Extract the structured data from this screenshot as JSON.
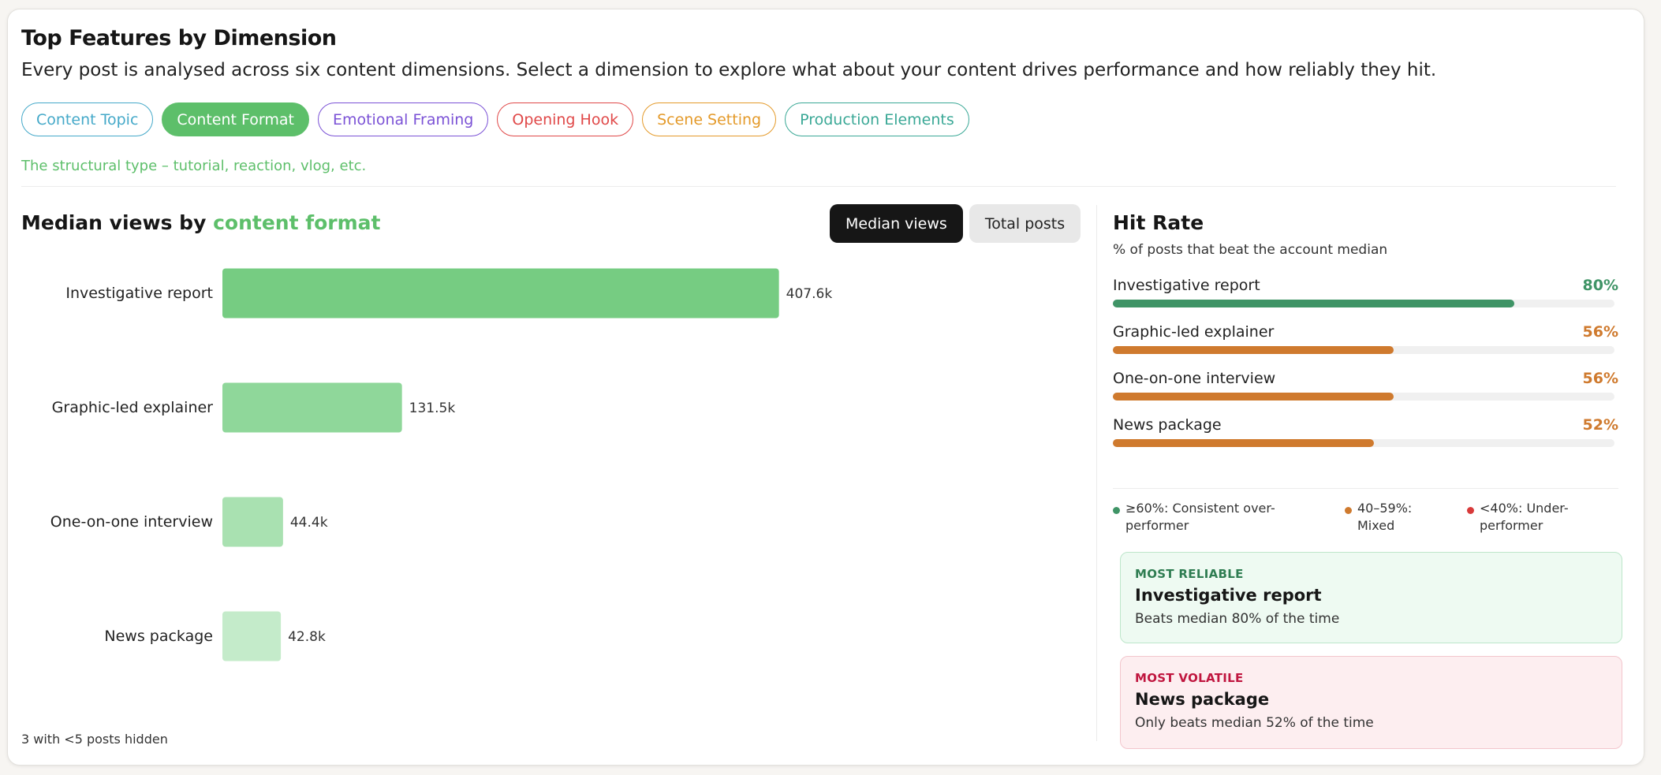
{
  "header": {
    "title": "Top Features by Dimension",
    "subtitle": "Every post is analysed across six content dimensions. Select a dimension to explore what about your content drives performance and how reliably they hit."
  },
  "dimensions": [
    {
      "label": "Content Topic",
      "color": "#45a9c9",
      "active": false
    },
    {
      "label": "Content Format",
      "color": "#5dbf6a",
      "active": true
    },
    {
      "label": "Emotional Framing",
      "color": "#7b52d6",
      "active": false
    },
    {
      "label": "Opening Hook",
      "color": "#e04848",
      "active": false
    },
    {
      "label": "Scene Setting",
      "color": "#e49a2a",
      "active": false
    },
    {
      "label": "Production Elements",
      "color": "#3aa896",
      "active": false
    }
  ],
  "dimension_description": "The structural type – tutorial, reaction, vlog, etc.",
  "chart_header": {
    "prefix": "Median views by",
    "accent": "content format"
  },
  "toggle": {
    "median_label": "Median views",
    "total_label": "Total posts",
    "active": "median"
  },
  "chart_data": {
    "type": "bar",
    "orientation": "horizontal",
    "categories": [
      "Investigative report",
      "Graphic-led explainer",
      "One-on-one interview",
      "News package"
    ],
    "values": [
      407600,
      131500,
      44400,
      42800
    ],
    "value_labels": [
      "407.6k",
      "131.5k",
      "44.4k",
      "42.8k"
    ],
    "bar_colors": [
      "#76cc82",
      "#8fd79a",
      "#a9e1b1",
      "#c4ebca"
    ],
    "xlim": [
      0,
      800000
    ]
  },
  "footnote": "3 with <5 posts hidden",
  "hit_rate": {
    "title": "Hit Rate",
    "subtitle": "% of posts that beat the account median",
    "rows": [
      {
        "label": "Investigative report",
        "pct_text": "80%",
        "pct": 80,
        "color": "#3f9466",
        "text_color": "#3f9466"
      },
      {
        "label": "Graphic-led explainer",
        "pct_text": "56%",
        "pct": 56,
        "color": "#cf7a2e",
        "text_color": "#cf7a2e"
      },
      {
        "label": "One-on-one interview",
        "pct_text": "56%",
        "pct": 56,
        "color": "#cf7a2e",
        "text_color": "#cf7a2e"
      },
      {
        "label": "News package",
        "pct_text": "52%",
        "pct": 52,
        "color": "#cf7a2e",
        "text_color": "#cf7a2e"
      }
    ],
    "legend": [
      {
        "line1": "≥60%: Consistent over-",
        "line2": "performer",
        "color": "#3f9466"
      },
      {
        "line1": "40–59%:",
        "line2": "Mixed",
        "color": "#cf7a2e"
      },
      {
        "line1": "<40%: Under-",
        "line2": "performer",
        "color": "#d83a3a"
      }
    ]
  },
  "most_reliable": {
    "tag": "MOST RELIABLE",
    "name": "Investigative report",
    "desc": "Beats median 80% of the time"
  },
  "most_volatile": {
    "tag": "MOST VOLATILE",
    "name": "News package",
    "desc": "Only beats median 52% of the time"
  }
}
